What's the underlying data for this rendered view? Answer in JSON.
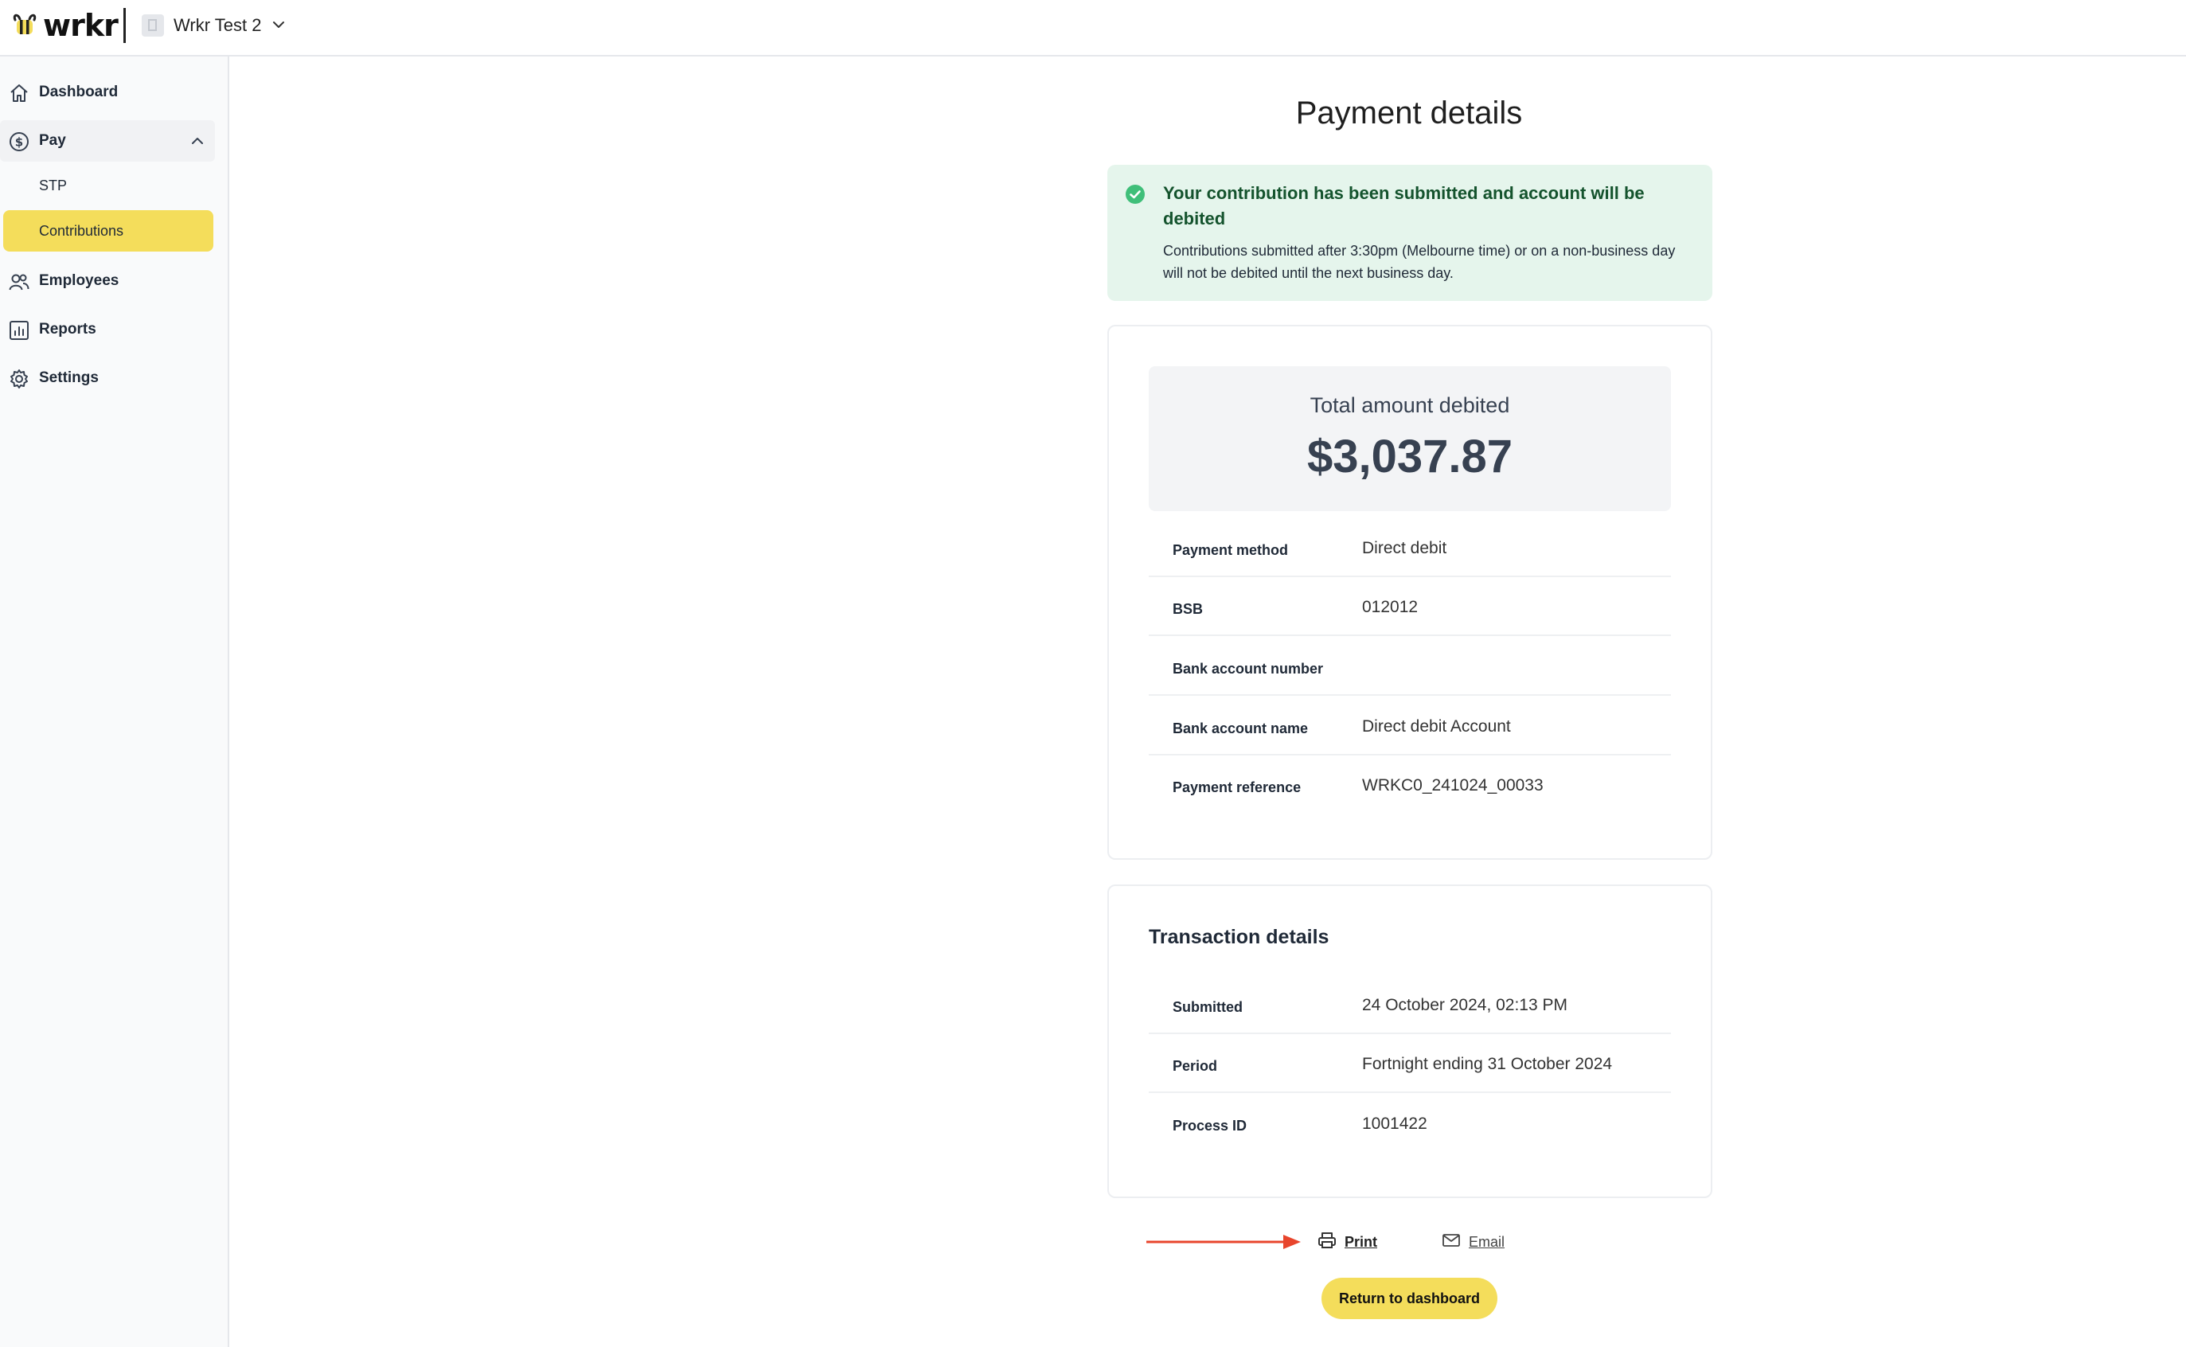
{
  "app": {
    "logo_text": "wrkr",
    "org_name": "Wrkr Test 2"
  },
  "icons": {
    "logo": "bee-logo-icon",
    "org": "document-icon",
    "org_dropdown": "chevron-down-icon",
    "dashboard": "home-icon",
    "pay": "dollar-circle-icon",
    "pay_toggle": "chevron-up-icon",
    "employees": "users-icon",
    "reports": "bar-chart-icon",
    "settings": "gear-icon",
    "alert": "check-circle-icon",
    "print": "printer-icon",
    "email": "envelope-icon",
    "annotation": "red-arrow-icon"
  },
  "sidebar": {
    "items": [
      {
        "label": "Dashboard"
      },
      {
        "label": "Pay",
        "expanded": true,
        "children": [
          {
            "label": "STP"
          },
          {
            "label": "Contributions",
            "active": true
          }
        ]
      },
      {
        "label": "Employees"
      },
      {
        "label": "Reports"
      },
      {
        "label": "Settings"
      }
    ]
  },
  "page": {
    "title": "Payment details"
  },
  "alert": {
    "title": "Your contribution has been submitted and account will be debited",
    "body": "Contributions submitted after 3:30pm (Melbourne time) or on a non-business day will not be debited until the next business day."
  },
  "payment": {
    "total_label": "Total amount debited",
    "total_value": "$3,037.87",
    "rows": [
      {
        "label": "Payment method",
        "value": "Direct debit"
      },
      {
        "label": "BSB",
        "value": "012012"
      },
      {
        "label": "Bank account number",
        "value": ""
      },
      {
        "label": "Bank account name",
        "value": "Direct debit Account"
      },
      {
        "label": "Payment reference",
        "value": "WRKC0_241024_00033"
      }
    ]
  },
  "transaction": {
    "title": "Transaction details",
    "rows": [
      {
        "label": "Submitted",
        "value": "24 October 2024, 02:13 PM"
      },
      {
        "label": "Period",
        "value": "Fortnight ending 31 October 2024"
      },
      {
        "label": "Process ID",
        "value": "1001422"
      }
    ]
  },
  "actions": {
    "print_label": "Print",
    "email_label": "Email",
    "return_label": "Return to dashboard"
  },
  "colors": {
    "accent": "#F4DD5B",
    "success_bg": "#E5F5EC",
    "success_icon": "#3FBF79",
    "annotation": "#E8452C"
  }
}
